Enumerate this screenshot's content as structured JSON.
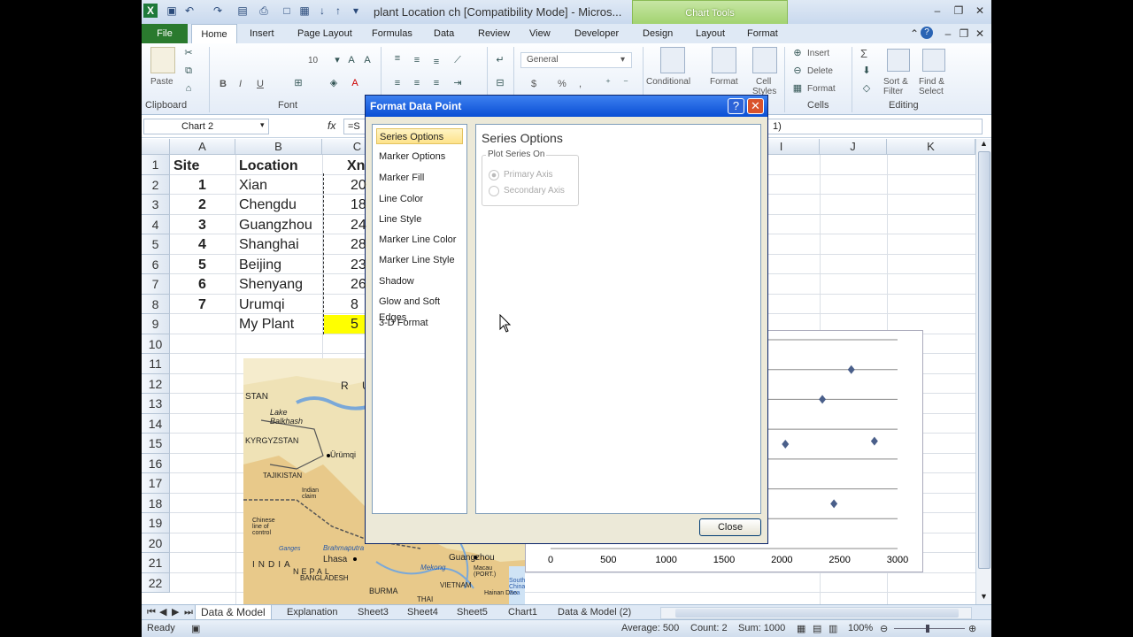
{
  "titlebar": {
    "title": "plant Location ch  [Compatibility Mode] - Micros...",
    "chart_tools": "Chart Tools"
  },
  "tabs": [
    "File",
    "Home",
    "Insert",
    "Page Layout",
    "Formulas",
    "Data",
    "Review",
    "View",
    "Developer",
    "Design",
    "Layout",
    "Format"
  ],
  "ribbon": {
    "clipboard": {
      "paste": "Paste",
      "label": "Clipboard"
    },
    "font": {
      "size": "10",
      "bold": "B",
      "italic": "I",
      "underline": "U",
      "label": "Font"
    },
    "number": {
      "format": "General",
      "currency": "$",
      "percent": "%",
      "comma": ","
    },
    "styles": {
      "conditional": "Conditional Formatting",
      "format_table": "Format as Table",
      "cell_styles": "Cell Styles"
    },
    "cells": {
      "insert": "Insert",
      "delete": "Delete",
      "format": "Format",
      "label": "Cells"
    },
    "editing": {
      "sum": "Σ",
      "sort": "Sort & Filter",
      "find": "Find & Select",
      "label": "Editing"
    }
  },
  "formula_bar": {
    "name_box": "Chart 2",
    "fx": "fx",
    "formula_prefix": "=S",
    "formula_suffix": "1)"
  },
  "columns": [
    "A",
    "B",
    "C",
    "I",
    "J",
    "K"
  ],
  "rows": [
    "1",
    "2",
    "3",
    "4",
    "5",
    "6",
    "7",
    "8",
    "9",
    "10",
    "11",
    "12",
    "13",
    "14",
    "15",
    "16",
    "17",
    "18",
    "19",
    "20",
    "21",
    "22"
  ],
  "table": {
    "headers": {
      "site": "Site",
      "location": "Location",
      "x": "Xn"
    },
    "rows": [
      {
        "site": "1",
        "location": "Xian",
        "x": "20"
      },
      {
        "site": "2",
        "location": "Chengdu",
        "x": "18"
      },
      {
        "site": "3",
        "location": "Guangzhou",
        "x": "24"
      },
      {
        "site": "4",
        "location": "Shanghai",
        "x": "28"
      },
      {
        "site": "5",
        "location": "Beijing",
        "x": "23"
      },
      {
        "site": "6",
        "location": "Shenyang",
        "x": "26"
      },
      {
        "site": "7",
        "location": "Urumqi",
        "x": "8"
      },
      {
        "site": "",
        "location": "My Plant",
        "x": "5"
      }
    ]
  },
  "map_labels": [
    "R U S",
    "STAN",
    "Lake Balkhash",
    "KYRGYZSTAN",
    "Ürümqi",
    "TAJIKISTAN",
    "Indian claim",
    "Chinese line of control",
    "Lhasa",
    "NEPAL",
    "Brahmaputra",
    "INDIA",
    "BANGLADESH",
    "BURMA",
    "Mekong",
    "Guangzhou",
    "Macau (PORT.)",
    "VIETNAM",
    "THAI",
    "Hainan Dao",
    "South China Sea",
    "Ganges"
  ],
  "chart_data": {
    "type": "scatter",
    "x_ticks": [
      0,
      500,
      1000,
      1500,
      2000,
      2500,
      3000
    ],
    "xlim": [
      0,
      3000
    ],
    "points": [
      {
        "x": 2600,
        "y": 6
      },
      {
        "x": 2350,
        "y": 5
      },
      {
        "x": 2030,
        "y": 3.5
      },
      {
        "x": 2800,
        "y": 3.6
      },
      {
        "x": 1850,
        "y": 2.8
      },
      {
        "x": 2450,
        "y": 1.5
      }
    ],
    "ylim": [
      0,
      7
    ]
  },
  "dialog": {
    "title": "Format Data Point",
    "help": "?",
    "close_x": "✕",
    "nav": [
      "Series Options",
      "Marker Options",
      "Marker Fill",
      "Line Color",
      "Line Style",
      "Marker Line Color",
      "Marker Line Style",
      "Shadow",
      "Glow and Soft Edges",
      "3-D Format"
    ],
    "selected": "Series Options",
    "panel_title": "Series Options",
    "group_title": "Plot Series On",
    "radio_primary": "Primary Axis",
    "radio_secondary": "Secondary Axis",
    "close_button": "Close"
  },
  "sheet_tabs": [
    "Data & Model",
    "Explanation",
    "Sheet3",
    "Sheet4",
    "Sheet5",
    "Chart1",
    "Data & Model (2)"
  ],
  "status": {
    "ready": "Ready",
    "average": "Average: 500",
    "count": "Count: 2",
    "sum": "Sum: 1000",
    "zoom": "100%"
  }
}
